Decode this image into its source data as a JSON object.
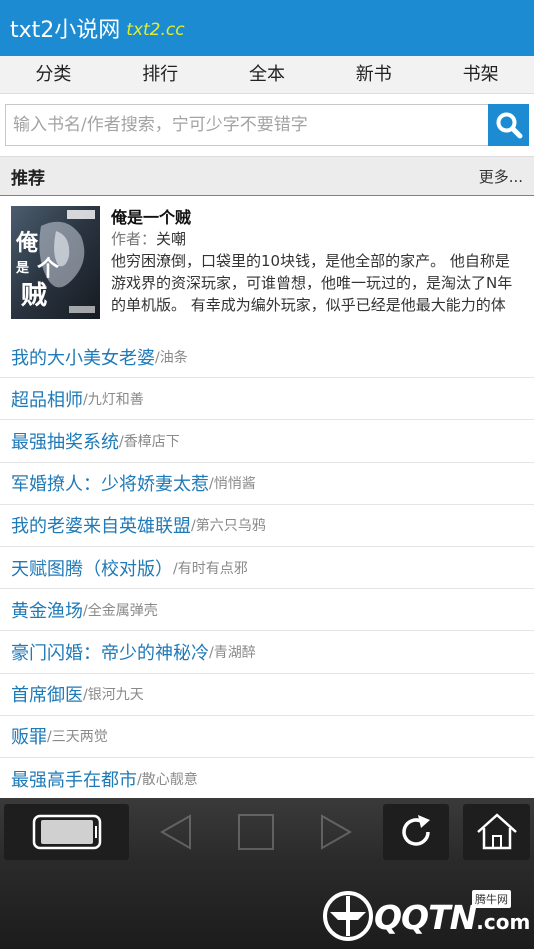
{
  "header": {
    "title": "txt2小说网",
    "domain": "txt2.cc"
  },
  "nav": [
    {
      "label": "分类"
    },
    {
      "label": "排行"
    },
    {
      "label": "全本"
    },
    {
      "label": "新书"
    },
    {
      "label": "书架"
    }
  ],
  "search": {
    "placeholder": "输入书名/作者搜索，宁可少字不要错字",
    "value": ""
  },
  "recommend": {
    "title": "推荐",
    "more": "更多...",
    "featured": {
      "title": "俺是一个贼",
      "author_label": "作者：",
      "author": "关嘲",
      "description": "他穷困潦倒，口袋里的10块钱，是他全部的家产。 他自称是游戏界的资深玩家，可谁曾想，他唯一玩过的，是淘汰了N年的单机版。 有幸成为编外玩家，似乎已经是他最大能力的体"
    }
  },
  "books": [
    {
      "title": "我的大小美女老婆",
      "author": "/油条"
    },
    {
      "title": "超品相师",
      "author": "/九灯和善"
    },
    {
      "title": "最强抽奖系统",
      "author": "/香樟店下"
    },
    {
      "title": "军婚撩人：少将娇妻太惹",
      "author": "/悄悄酱"
    },
    {
      "title": "我的老婆来自英雄联盟",
      "author": "/第六只乌鸦"
    },
    {
      "title": "天赋图腾（校对版）",
      "author": "/有时有点邪"
    },
    {
      "title": "黄金渔场",
      "author": "/全金属弹壳"
    },
    {
      "title": "豪门闪婚：帝少的神秘冷",
      "author": "/青湖醉"
    },
    {
      "title": "首席御医",
      "author": "/银河九天"
    },
    {
      "title": "贩罪",
      "author": "/三天两觉"
    },
    {
      "title": "最强高手在都市",
      "author": "/散心靓意"
    }
  ],
  "icons": {
    "search": "search-icon",
    "rotate": "rotate-screen-icon",
    "back": "back-arrow-icon",
    "tabs": "tabs-square-icon",
    "forward": "forward-arrow-icon",
    "refresh": "refresh-icon",
    "home": "home-icon"
  },
  "watermark": {
    "brand": "QQTN",
    "suffix": ".com",
    "badge": "腾牛网"
  },
  "colors": {
    "accent": "#1c8bd2",
    "link": "#1f7ab8",
    "domain": "#e3ee2a"
  }
}
